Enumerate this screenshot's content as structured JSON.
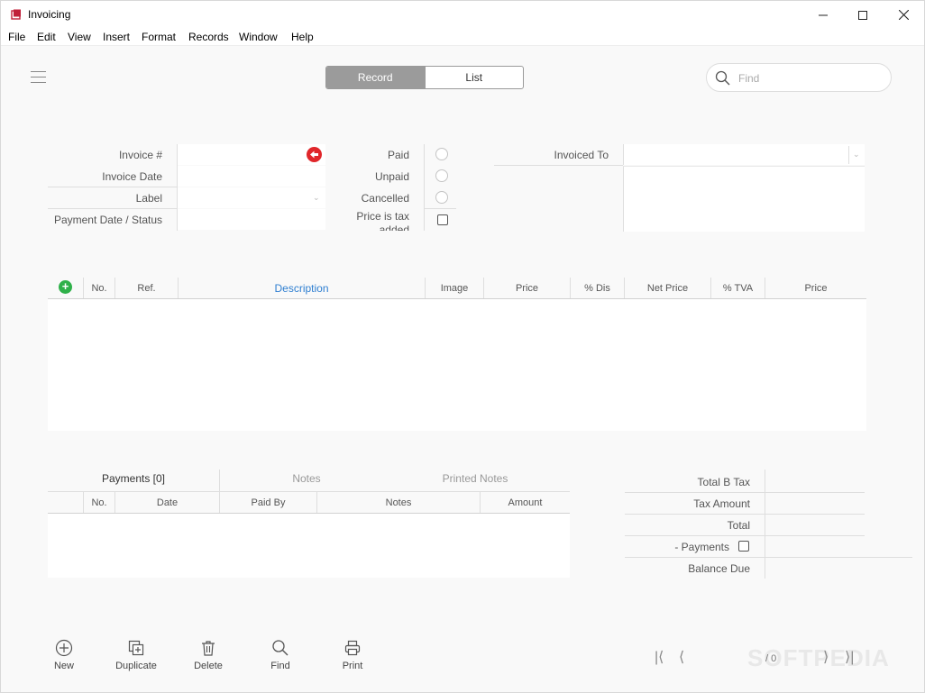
{
  "window": {
    "title": "Invoicing"
  },
  "menu": [
    "File",
    "Edit",
    "View",
    "Insert",
    "Format",
    "Records",
    "Window",
    "Help"
  ],
  "view_toggle": {
    "record": "Record",
    "list": "List"
  },
  "search": {
    "placeholder": "Find"
  },
  "invoice": {
    "invoice_no_label": "Invoice #",
    "invoice_date_label": "Invoice Date",
    "label_label": "Label",
    "payment_status_label": "Payment Date / Status",
    "paid_label": "Paid",
    "unpaid_label": "Unpaid",
    "cancelled_label": "Cancelled",
    "price_tax_label": "Price is tax added",
    "invoiced_to_label": "Invoiced To"
  },
  "items_table": {
    "columns": [
      "No.",
      "Ref.",
      "Description",
      "Image",
      "Price",
      "% Dis",
      "Net Price",
      "% TVA",
      "Price"
    ]
  },
  "payments": {
    "tabs": [
      "Payments [0]",
      "Notes",
      "Printed Notes"
    ],
    "columns": [
      "No.",
      "Date",
      "Paid By",
      "Notes",
      "Amount"
    ]
  },
  "totals": {
    "total_b_tax": "Total B Tax",
    "tax_amount": "Tax Amount",
    "total": "Total",
    "payments": "- Payments",
    "balance_due": "Balance Due"
  },
  "toolbar": {
    "new": "New",
    "duplicate": "Duplicate",
    "delete": "Delete",
    "find": "Find",
    "print": "Print"
  },
  "pagination": {
    "text": "/ 0"
  },
  "watermark": "SOFTPEDIA",
  "colors": {
    "accent_blue": "#2f7fd1",
    "add_green": "#2fb14a",
    "alert_red": "#e0262a",
    "segment_active": "#9b9b9b"
  }
}
